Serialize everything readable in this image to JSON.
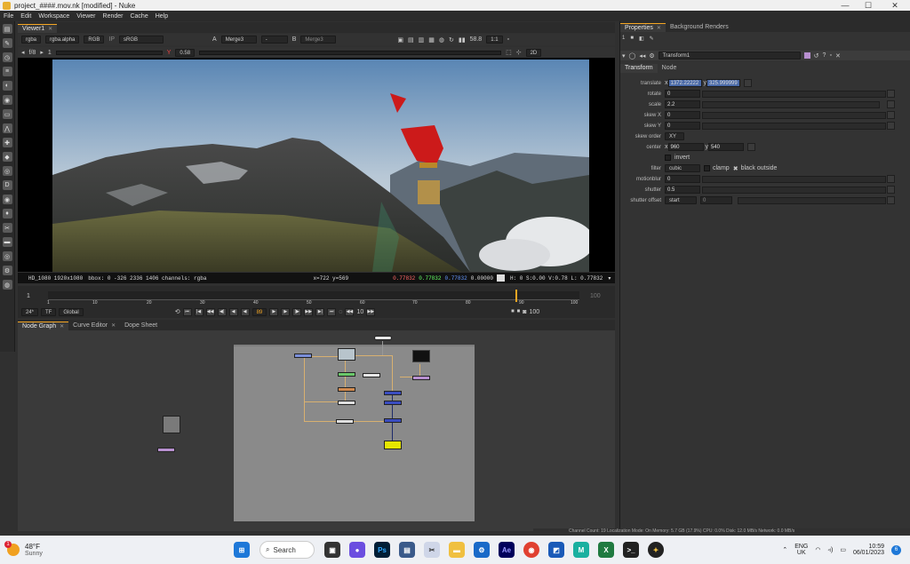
{
  "window": {
    "title": "project_####.mov.nk [modified] - Nuke"
  },
  "menu": [
    "File",
    "Edit",
    "Workspace",
    "Viewer",
    "Render",
    "Cache",
    "Help"
  ],
  "viewer": {
    "tab": "Viewer1",
    "channels": "rgba",
    "layer": "rgba.alpha",
    "rgb": "RGB",
    "ip_label": "IP",
    "colorspace": "sRGB",
    "input_a_label": "A",
    "input_a": "Merge3",
    "composite": "-",
    "input_b_label": "B",
    "input_b": "Merge3",
    "zoom": "58.8",
    "proxy": "1:1",
    "view_mode": "2D",
    "fstop": "f/8",
    "frame_step": "1",
    "gain_symbol": "Y",
    "gain": "0.58",
    "info": {
      "format": "HD_1080 1920x1080",
      "bbox": "bbox: 0 -326 2336 1406 channels: rgba",
      "coords": "x=722 y=569",
      "r": "0.77832",
      "g": "0.77832",
      "b": "0.77832",
      "a": "0.00000",
      "hsv": "H:  0 S:0.00 V:0.78  L: 0.77832"
    },
    "timeline": {
      "start": "1",
      "end": "100",
      "current": "89",
      "ticks": [
        "1",
        "10",
        "20",
        "30",
        "40",
        "50",
        "60",
        "70",
        "80",
        "90",
        "100"
      ],
      "fps": "24*",
      "tf": "TF",
      "scope": "Global",
      "step": "10",
      "out": "100"
    }
  },
  "bottom_tabs": [
    "Node Graph",
    "Curve Editor",
    "Dope Sheet"
  ],
  "properties": {
    "tabs": [
      "Properties",
      "Background Renders"
    ],
    "count": "1",
    "node_name": "Transform1",
    "node_tabs": [
      "Transform",
      "Node"
    ],
    "rows": [
      {
        "label": "translate",
        "x": "1372.22222",
        "y": "325.999999"
      },
      {
        "label": "rotate",
        "value": "0"
      },
      {
        "label": "scale",
        "value": "2.2"
      },
      {
        "label": "skew X",
        "value": "0"
      },
      {
        "label": "skew Y",
        "value": "0"
      },
      {
        "label": "skew order",
        "value": "XY"
      },
      {
        "label": "center",
        "x": "960",
        "y": "540"
      },
      {
        "label": "invert"
      },
      {
        "label": "filter",
        "value": "cubic"
      },
      {
        "label": "motionblur",
        "value": "0"
      },
      {
        "label": "shutter",
        "value": "0.5"
      },
      {
        "label": "shutter offset",
        "value": "start",
        "extra": "0"
      }
    ],
    "clamp_label": "clamp",
    "black_outside_label": "black outside",
    "x_label": "x",
    "y_label": "y"
  },
  "statusbar": "Channel Count: 19  Localization Mode: On  Memory: 5.7 GB (17.9%)  CPU: 0.0%  Disk: 12.0 MB/s  Network: 0.0 MB/s",
  "taskbar": {
    "weather_temp": "48°F",
    "weather_desc": "Sunny",
    "weather_badge": "1",
    "search": "Search",
    "lang1": "ENG",
    "lang2": "UK",
    "time": "10:59",
    "date": "06/01/2023",
    "notif": "6"
  }
}
